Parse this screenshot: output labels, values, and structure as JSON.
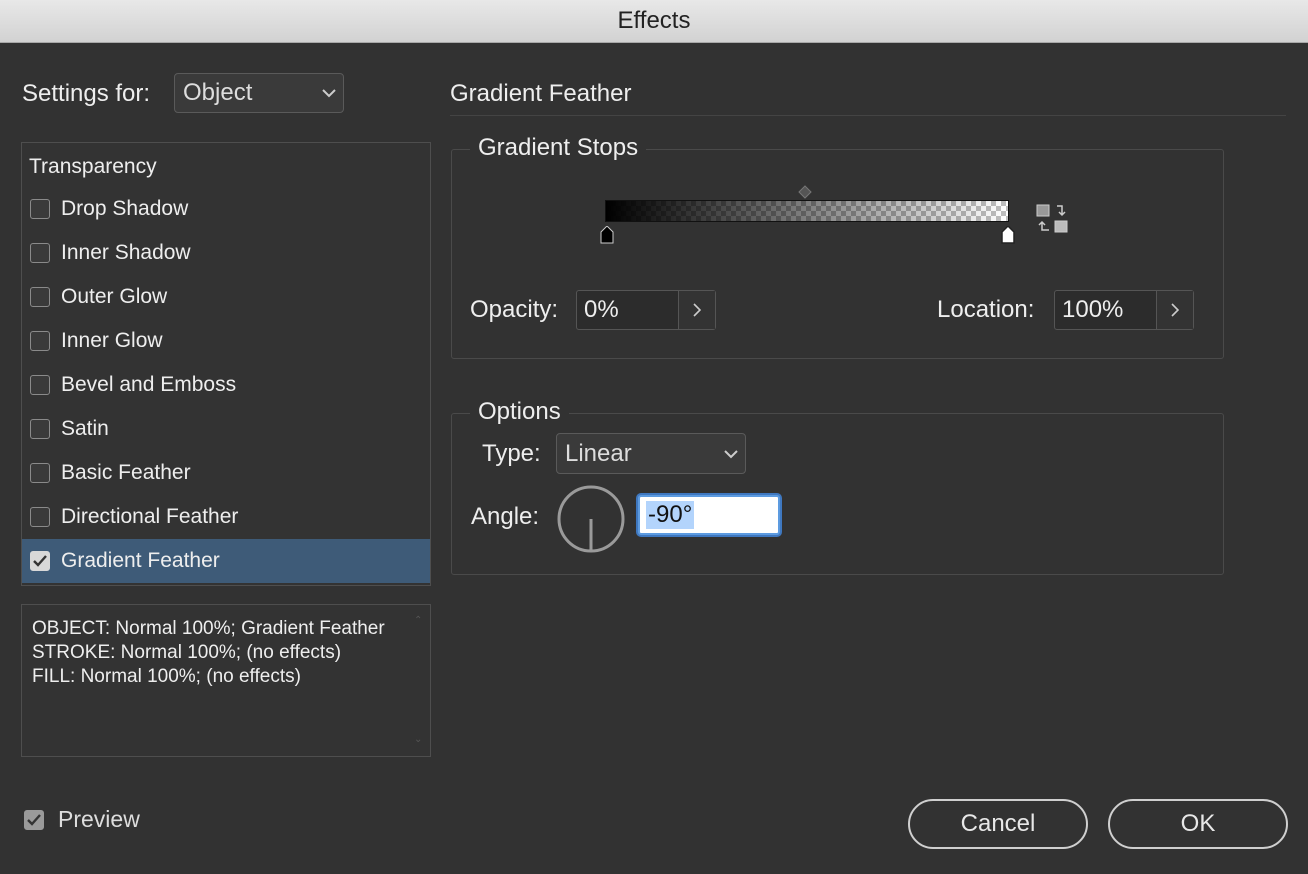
{
  "window": {
    "title": "Effects"
  },
  "settings": {
    "label": "Settings for:",
    "value": "Object"
  },
  "effects_list": {
    "header": "Transparency",
    "items": [
      {
        "label": "Drop Shadow",
        "checked": false
      },
      {
        "label": "Inner Shadow",
        "checked": false
      },
      {
        "label": "Outer Glow",
        "checked": false
      },
      {
        "label": "Inner Glow",
        "checked": false
      },
      {
        "label": "Bevel and Emboss",
        "checked": false
      },
      {
        "label": "Satin",
        "checked": false
      },
      {
        "label": "Basic Feather",
        "checked": false
      },
      {
        "label": "Directional Feather",
        "checked": false
      },
      {
        "label": "Gradient Feather",
        "checked": true,
        "selected": true
      }
    ]
  },
  "summary": {
    "line1": "OBJECT: Normal 100%; Gradient Feather",
    "line2": "STROKE: Normal 100%; (no effects)",
    "line3": "FILL: Normal 100%; (no effects)"
  },
  "preview": {
    "label": "Preview",
    "checked": true
  },
  "panel": {
    "title": "Gradient Feather",
    "gradient_stops": {
      "label": "Gradient Stops",
      "opacity_label": "Opacity:",
      "opacity_value": "0%",
      "location_label": "Location:",
      "location_value": "100%"
    },
    "options": {
      "label": "Options",
      "type_label": "Type:",
      "type_value": "Linear",
      "angle_label": "Angle:",
      "angle_value": "-90°"
    }
  },
  "buttons": {
    "cancel": "Cancel",
    "ok": "OK"
  },
  "colors": {
    "background": "#323232",
    "selection": "#3e5b78",
    "focus": "#5d9be0"
  }
}
